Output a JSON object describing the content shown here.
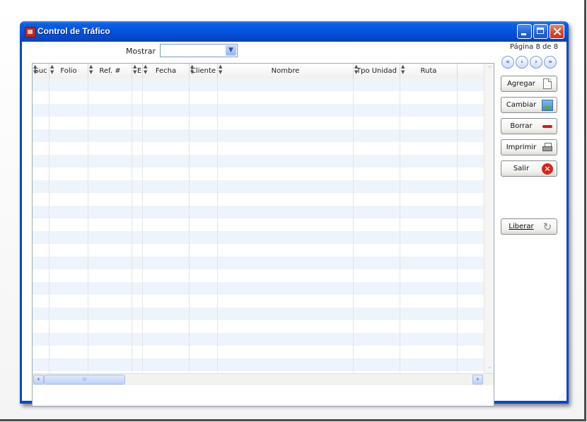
{
  "window": {
    "title": "Control de Tráfico"
  },
  "filter": {
    "label": "Mostrar",
    "selected": ""
  },
  "pagination": {
    "indicator": "Página 8 de 8",
    "first": "«",
    "prev": "‹",
    "next": "›",
    "last": "»"
  },
  "grid": {
    "columns": [
      "Suc",
      "Folio",
      "Ref. #",
      "E",
      "Fecha",
      "Cliente",
      "Nombre",
      "Tpo Unidad",
      "Ruta"
    ],
    "rows": []
  },
  "actions": {
    "agregar": "Agregar",
    "cambiar": "Cambiar",
    "borrar": "Borrar",
    "imprimir": "Imprimir",
    "salir": "Salir",
    "liberar": "Liberar"
  },
  "icons": {
    "app": "app-icon",
    "agregar": "page-icon",
    "cambiar": "picture-icon",
    "borrar": "minus-icon",
    "imprimir": "printer-icon",
    "salir": "close-circle-icon",
    "liberar": "refresh-icon"
  },
  "colors": {
    "titlebar": "#0553de",
    "row_alt": "#eef4fc",
    "close_button": "#d9492a"
  }
}
